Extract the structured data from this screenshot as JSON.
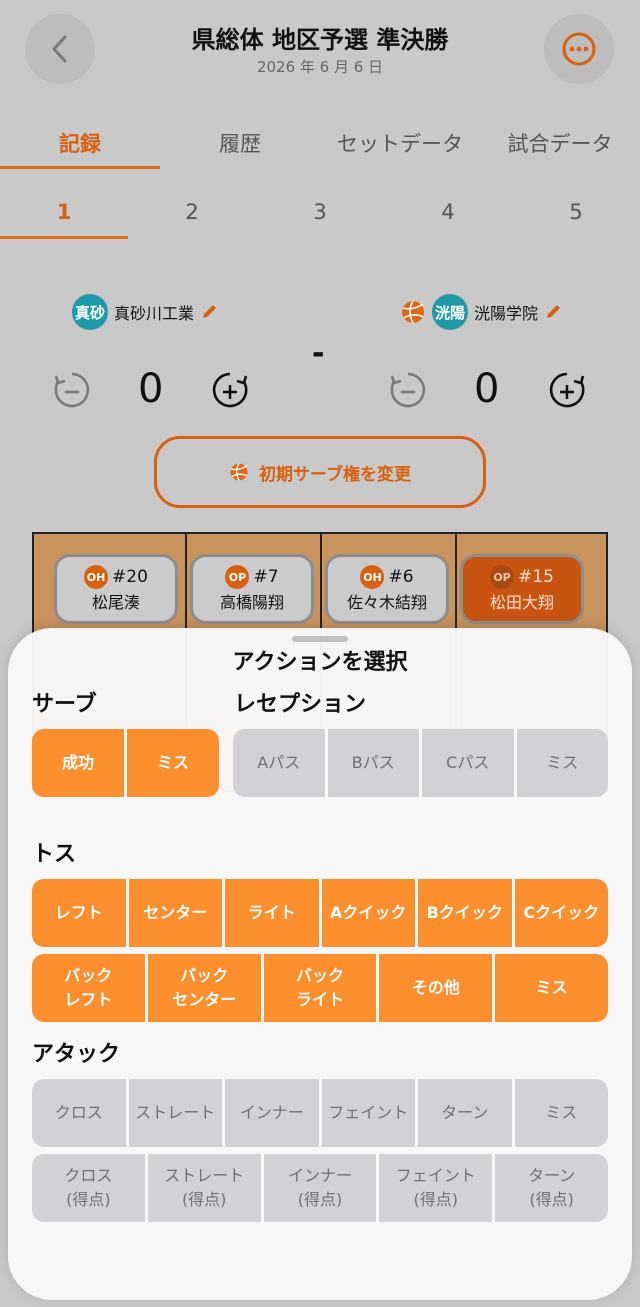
{
  "header": {
    "title": "県総体 地区予選 準決勝",
    "date": "2026 年 6 月 6 日"
  },
  "tabs": [
    "記録",
    "履歴",
    "セットデータ",
    "試合データ"
  ],
  "sets": [
    "1",
    "2",
    "3",
    "4",
    "5"
  ],
  "teams": {
    "home": {
      "badge": "真砂",
      "name": "真砂川工業",
      "score": "0"
    },
    "away": {
      "badge": "洸陽",
      "name": "洸陽学院",
      "score": "0"
    }
  },
  "vs": "-",
  "serve_change_label": "初期サーブ権を変更",
  "players": [
    {
      "pos": "OH",
      "number": "#20",
      "name": "松尾湊"
    },
    {
      "pos": "OP",
      "number": "#7",
      "name": "高橋陽翔"
    },
    {
      "pos": "OH",
      "number": "#6",
      "name": "佐々木結翔"
    },
    {
      "pos": "OP",
      "number": "#15",
      "name": "松田大翔"
    }
  ],
  "sheet": {
    "title": "アクションを選択",
    "serve": {
      "label": "サーブ",
      "buttons": [
        "成功",
        "ミス"
      ]
    },
    "reception": {
      "label": "レセプション",
      "buttons": [
        "Aパス",
        "Bパス",
        "Cパス",
        "ミス"
      ]
    },
    "toss": {
      "label": "トス",
      "row1": [
        "レフト",
        "センター",
        "ライト",
        "Aクイック",
        "Bクイック",
        "Cクイック"
      ],
      "row2": [
        {
          "l1": "バック",
          "l2": "レフト"
        },
        {
          "l1": "バック",
          "l2": "センター"
        },
        {
          "l1": "バック",
          "l2": "ライト"
        },
        {
          "l1": "その他",
          "l2": ""
        },
        {
          "l1": "ミス",
          "l2": ""
        }
      ]
    },
    "attack": {
      "label": "アタック",
      "row1": [
        "クロス",
        "ストレート",
        "インナー",
        "フェイント",
        "ターン",
        "ミス"
      ],
      "row2": [
        {
          "l1": "クロス",
          "l2": "(得点)"
        },
        {
          "l1": "ストレート",
          "l2": "(得点)"
        },
        {
          "l1": "インナー",
          "l2": "(得点)"
        },
        {
          "l1": "フェイント",
          "l2": "(得点)"
        },
        {
          "l1": "ターン",
          "l2": "(得点)"
        }
      ]
    }
  },
  "colors": {
    "accent": "#e0681a",
    "action_orange": "#fb8f2e",
    "team_badge": "#1e9aa6",
    "selected_player": "#c85410"
  }
}
